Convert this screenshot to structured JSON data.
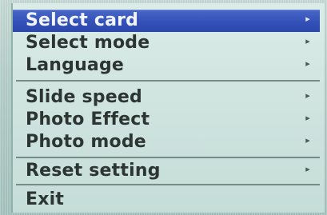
{
  "menu": {
    "items": [
      {
        "label": "Select card",
        "arrow": "▸",
        "selected": true
      },
      {
        "label": "Select mode",
        "arrow": "▸"
      },
      {
        "label": "Language",
        "arrow": "▸"
      },
      {
        "label": "Slide speed",
        "arrow": "▸"
      },
      {
        "label": "Photo Effect",
        "arrow": "▸"
      },
      {
        "label": "Photo mode",
        "arrow": "▸"
      },
      {
        "label": "Reset setting",
        "arrow": "▸"
      },
      {
        "label": "Exit"
      }
    ],
    "colors": {
      "highlight": "#3451b8",
      "text": "#2c3532",
      "background": "#cfe3df"
    }
  }
}
